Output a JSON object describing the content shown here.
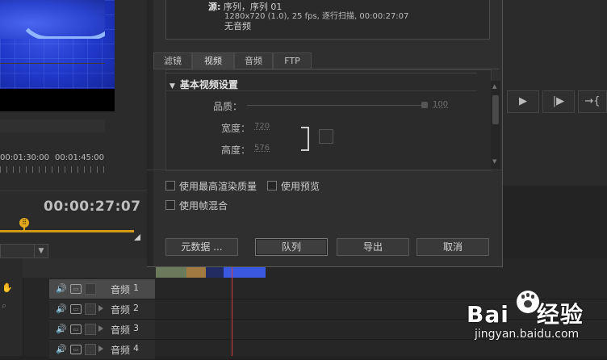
{
  "left_monitor": {
    "timecode": "00:00:27:07",
    "playhead_glyph": "⠿"
  },
  "right_monitor": {
    "buttons": [
      "▶",
      "|▶",
      "→{"
    ],
    "ruler_times": [
      "00:01:30:00",
      "00:01:45:00"
    ]
  },
  "dialog": {
    "source": {
      "label": "源:",
      "value": "序列，序列 01",
      "video_info": "1280x720 (1.0), 25 fps, 逐行扫描, 00:00:27:07",
      "audio_info": "无音频"
    },
    "tabs": [
      {
        "label": "滤镜",
        "active": false
      },
      {
        "label": "视频",
        "active": true
      },
      {
        "label": "音频",
        "active": false
      },
      {
        "label": "FTP",
        "active": false
      }
    ],
    "video_settings": {
      "section_title": "基本视频设置",
      "quality_label": "品质：",
      "quality_value": "100",
      "width_label": "宽度：",
      "width_value": "720",
      "height_label": "高度：",
      "height_value": "576"
    },
    "options": {
      "max_render_quality": "使用最高渲染质量",
      "use_preview": "使用预览",
      "frame_blending": "使用帧混合"
    },
    "buttons": {
      "metadata": "元数据 ...",
      "queue": "队列",
      "export": "导出",
      "cancel": "取消"
    }
  },
  "timeline": {
    "tracks": [
      {
        "label": "音频",
        "num": "1",
        "selected": true
      },
      {
        "label": "音频",
        "num": "2",
        "selected": false
      },
      {
        "label": "音频",
        "num": "3",
        "selected": false
      },
      {
        "label": "音频",
        "num": "4",
        "selected": false
      }
    ]
  },
  "watermark": {
    "text_a": "Bai",
    "text_b": "经验",
    "url": "jingyan.baidu.com"
  },
  "colors": {
    "accent_scrub": "#d39a16",
    "playhead_red": "#d23c3c",
    "video_blue": "#2a43d0"
  }
}
